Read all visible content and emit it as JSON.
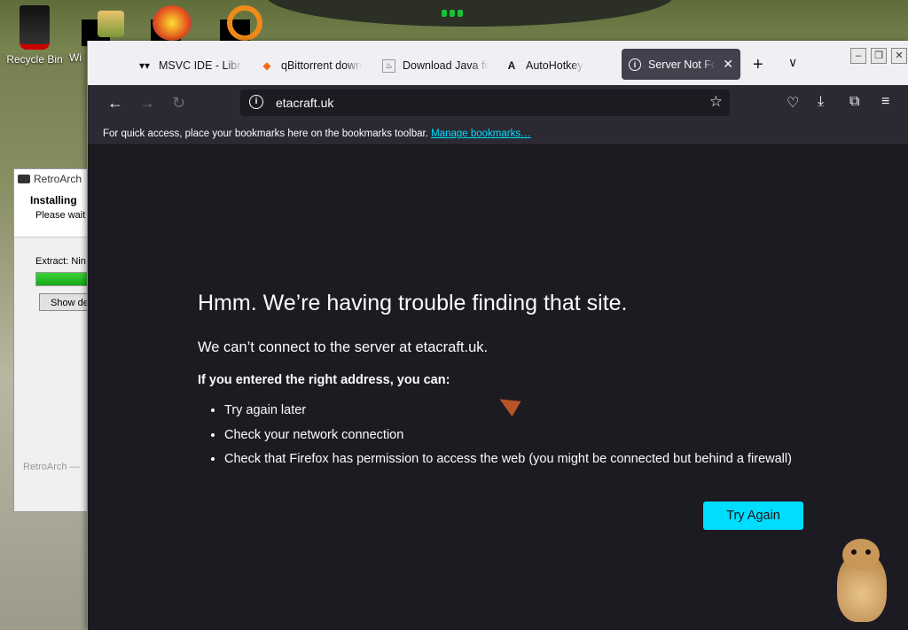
{
  "desktop": {
    "icons": [
      {
        "label": "Recycle Bin"
      },
      {
        "label": "Wi"
      }
    ]
  },
  "retroarch": {
    "title": "RetroArch",
    "heading": "Installing",
    "subheading": "Please wait",
    "extract": "Extract: Nin",
    "progress": 0.95,
    "show_details": "Show de",
    "footer": "RetroArch —"
  },
  "browser": {
    "tabs": [
      {
        "label": "MSVC IDE - Libre",
        "icon": "gamepad-icon"
      },
      {
        "label": "qBittorrent down",
        "icon": "qbittorrent-icon"
      },
      {
        "label": "Download Java fo",
        "icon": "java-icon"
      },
      {
        "label": "AutoHotkey",
        "icon": "autohotkey-icon"
      },
      {
        "label": "Server Not Fou",
        "icon": "info-icon",
        "active": true
      }
    ],
    "url": "etacraft.uk",
    "bookmarks_bar": {
      "text": "For quick access, place your bookmarks here on the bookmarks toolbar.",
      "link": "Manage bookmarks…"
    },
    "error": {
      "title": "Hmm. We’re having trouble finding that site.",
      "subtitle": "We can’t connect to the server at etacraft.uk.",
      "lead": "If you entered the right address, you can:",
      "suggestions": [
        "Try again later",
        "Check your network connection",
        "Check that Firefox has permission to access the web (you might be connected but behind a firewall)"
      ],
      "button": "Try Again"
    }
  },
  "colors": {
    "page_bg": "#1c1b22",
    "toolbar_bg": "#2b2a33",
    "accent": "#00ddff"
  }
}
